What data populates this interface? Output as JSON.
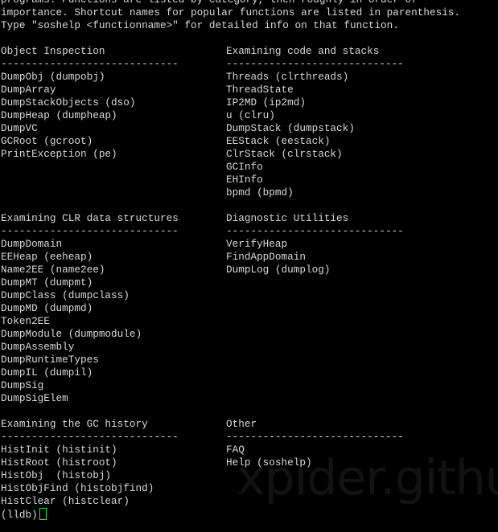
{
  "intro": [
    "programs. Functions are listed by category, then roughly in order of",
    "importance. Shortcut names for popular functions are listed in parenthesis.",
    "Type \"soshelp <functionname>\" for detailed info on that function."
  ],
  "sections": [
    {
      "left": {
        "title": "Object Inspection",
        "divider": "-----------------------------",
        "items": [
          "DumpObj (dumpobj)",
          "DumpArray",
          "DumpStackObjects (dso)",
          "DumpHeap (dumpheap)",
          "DumpVC",
          "GCRoot (gcroot)",
          "PrintException (pe)"
        ]
      },
      "right": {
        "title": "Examining code and stacks",
        "divider": "-----------------------------",
        "items": [
          "Threads (clrthreads)",
          "ThreadState",
          "IP2MD (ip2md)",
          "u (clru)",
          "DumpStack (dumpstack)",
          "EEStack (eestack)",
          "ClrStack (clrstack)",
          "GCInfo",
          "EHInfo",
          "bpmd (bpmd)"
        ]
      }
    },
    {
      "left": {
        "title": "Examining CLR data structures",
        "divider": "-----------------------------",
        "items": [
          "DumpDomain",
          "EEHeap (eeheap)",
          "Name2EE (name2ee)",
          "DumpMT (dumpmt)",
          "DumpClass (dumpclass)",
          "DumpMD (dumpmd)",
          "Token2EE",
          "DumpModule (dumpmodule)",
          "DumpAssembly",
          "DumpRuntimeTypes",
          "DumpIL (dumpil)",
          "DumpSig",
          "DumpSigElem"
        ]
      },
      "right": {
        "title": "Diagnostic Utilities",
        "divider": "-----------------------------",
        "items": [
          "VerifyHeap",
          "FindAppDomain",
          "DumpLog (dumplog)"
        ]
      }
    },
    {
      "left": {
        "title": "Examining the GC history",
        "divider": "-----------------------------",
        "items": [
          "HistInit (histinit)",
          "HistRoot (histroot)",
          "HistObj  (histobj)",
          "HistObjFind (histobjfind)",
          "HistClear (histclear)"
        ]
      },
      "right": {
        "title": "Other",
        "divider": "-----------------------------",
        "items": [
          "FAQ",
          "Help (soshelp)"
        ]
      }
    }
  ],
  "prompt": "(lldb)",
  "watermark": "xpider.github.io",
  "colors": {
    "background": "#000000",
    "text": "#d8d8d8",
    "cursor": "#2fe22f"
  }
}
